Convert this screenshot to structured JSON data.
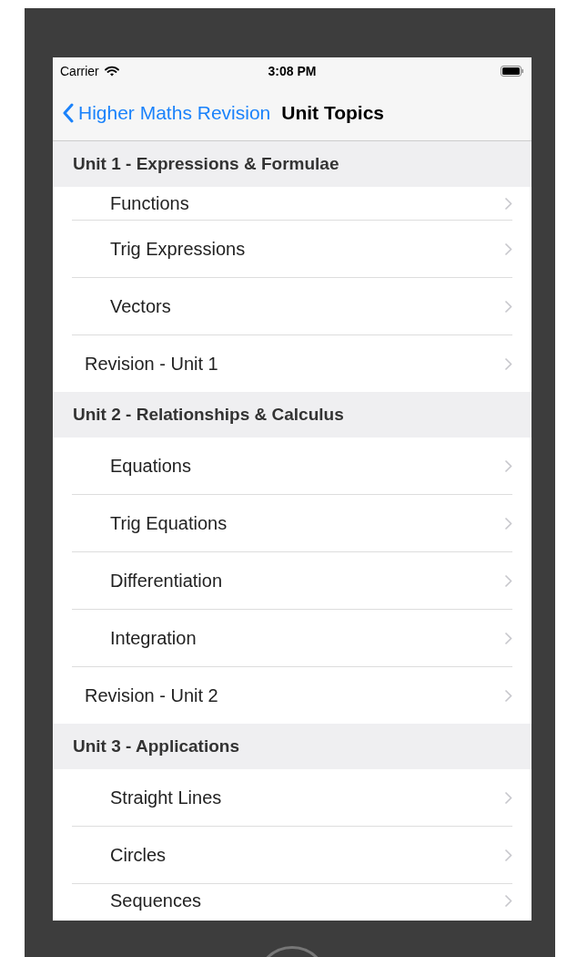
{
  "status_bar": {
    "carrier": "Carrier",
    "time": "3:08 PM"
  },
  "nav_bar": {
    "back": "Higher Maths Revision",
    "title": "Unit Topics"
  },
  "sections": [
    {
      "title": "Unit 1 - Expressions & Formulae",
      "rows": [
        {
          "label": "Functions",
          "kind": "topic",
          "cut": true
        },
        {
          "label": "Trig Expressions",
          "kind": "topic"
        },
        {
          "label": "Vectors",
          "kind": "topic"
        },
        {
          "label": "Revision  - Unit 1",
          "kind": "revision"
        }
      ]
    },
    {
      "title": "Unit 2 - Relationships & Calculus",
      "rows": [
        {
          "label": "Equations",
          "kind": "topic"
        },
        {
          "label": "Trig Equations",
          "kind": "topic"
        },
        {
          "label": "Differentiation",
          "kind": "topic"
        },
        {
          "label": "Integration",
          "kind": "topic"
        },
        {
          "label": "Revision - Unit 2",
          "kind": "revision"
        }
      ]
    },
    {
      "title": "Unit 3 - Applications",
      "rows": [
        {
          "label": "Straight Lines",
          "kind": "topic"
        },
        {
          "label": "Circles",
          "kind": "topic"
        },
        {
          "label": "Sequences",
          "kind": "topic",
          "cut": true
        }
      ]
    }
  ]
}
